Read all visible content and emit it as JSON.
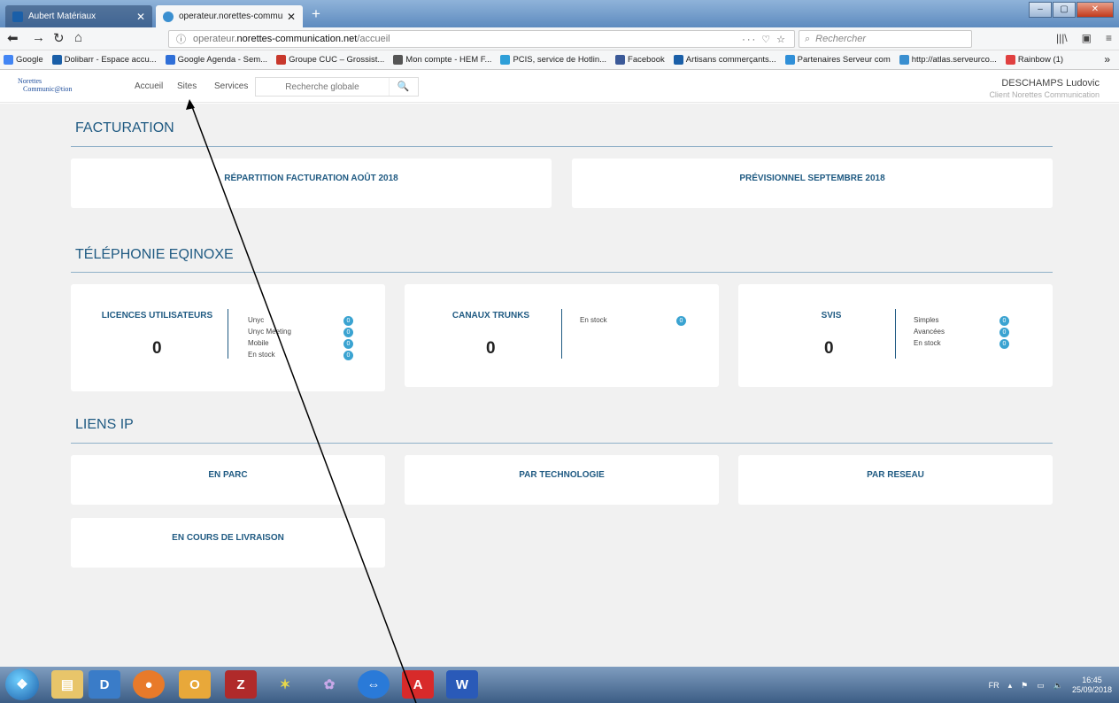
{
  "browser": {
    "tabs": [
      {
        "label": "Aubert Matériaux",
        "close": "✕",
        "icon_color": "#1a5fa8"
      },
      {
        "label": "operateur.norettes-communica",
        "close": "✕",
        "icon_color": "#3a8fd0"
      }
    ],
    "new_tab": "+",
    "url": {
      "info_icon": "ⓘ",
      "prefix": "operateur.",
      "domain": "norettes-communication.net",
      "path": "/accueil",
      "actions": "··· ♡ ☆"
    },
    "search_placeholder": "Rechercher",
    "bookmarks": [
      {
        "label": "Google",
        "color": "#4285f4"
      },
      {
        "label": "Dolibarr - Espace accu...",
        "color": "#1a5fa8"
      },
      {
        "label": "Google Agenda - Sem...",
        "color": "#2f6fd8"
      },
      {
        "label": "Groupe CUC – Grossist...",
        "color": "#c8382c"
      },
      {
        "label": "Mon compte - HEM F...",
        "color": "#555555"
      },
      {
        "label": "PCIS, service de Hotlin...",
        "color": "#2f9fd8"
      },
      {
        "label": "Facebook",
        "color": "#3b5998"
      },
      {
        "label": "Artisans commerçants...",
        "color": "#1a5fa8"
      },
      {
        "label": "Partenaires Serveur com",
        "color": "#2f8fd8"
      },
      {
        "label": "http://atlas.serveurco...",
        "color": "#3a8fd0"
      },
      {
        "label": "Rainbow (1)",
        "color": "#e04040"
      }
    ],
    "bookmarks_more": "»"
  },
  "header": {
    "logo_line1": "Norettes",
    "logo_line2": "Communic@tion",
    "nav": [
      "Accueil",
      "Sites",
      "Services"
    ],
    "search_placeholder": "Recherche globale",
    "user_name": "DESCHAMPS Ludovic",
    "user_role": "Client Norettes Communication"
  },
  "sections": {
    "facturation": {
      "title": "FACTURATION",
      "cards": [
        "RÉPARTITION FACTURATION AOÛT 2018",
        "PRÉVISIONNEL SEPTEMBRE 2018"
      ]
    },
    "telephonie": {
      "title": "TÉLÉPHONIE EQINOXE",
      "licences": {
        "title": "LICENCES UTILISATEURS",
        "value": "0",
        "items": [
          {
            "label": "Unyc",
            "count": "0"
          },
          {
            "label": "Unyc Meeting",
            "count": "0"
          },
          {
            "label": "Mobile",
            "count": "0"
          },
          {
            "label": "En stock",
            "count": "0"
          }
        ]
      },
      "trunks": {
        "title": "CANAUX TRUNKS",
        "value": "0",
        "items": [
          {
            "label": "En stock",
            "count": "0"
          }
        ]
      },
      "svis": {
        "title": "SVIS",
        "value": "0",
        "items": [
          {
            "label": "Simples",
            "count": "0"
          },
          {
            "label": "Avancées",
            "count": "0"
          },
          {
            "label": "En stock",
            "count": "0"
          }
        ]
      }
    },
    "liens_ip": {
      "title": "LIENS IP",
      "cards": [
        "EN PARC",
        "PAR TECHNOLOGIE",
        "PAR RESEAU",
        "EN COURS DE LIVRAISON"
      ]
    }
  },
  "taskbar": {
    "lang": "FR",
    "time": "16:45",
    "date": "25/09/2018"
  }
}
